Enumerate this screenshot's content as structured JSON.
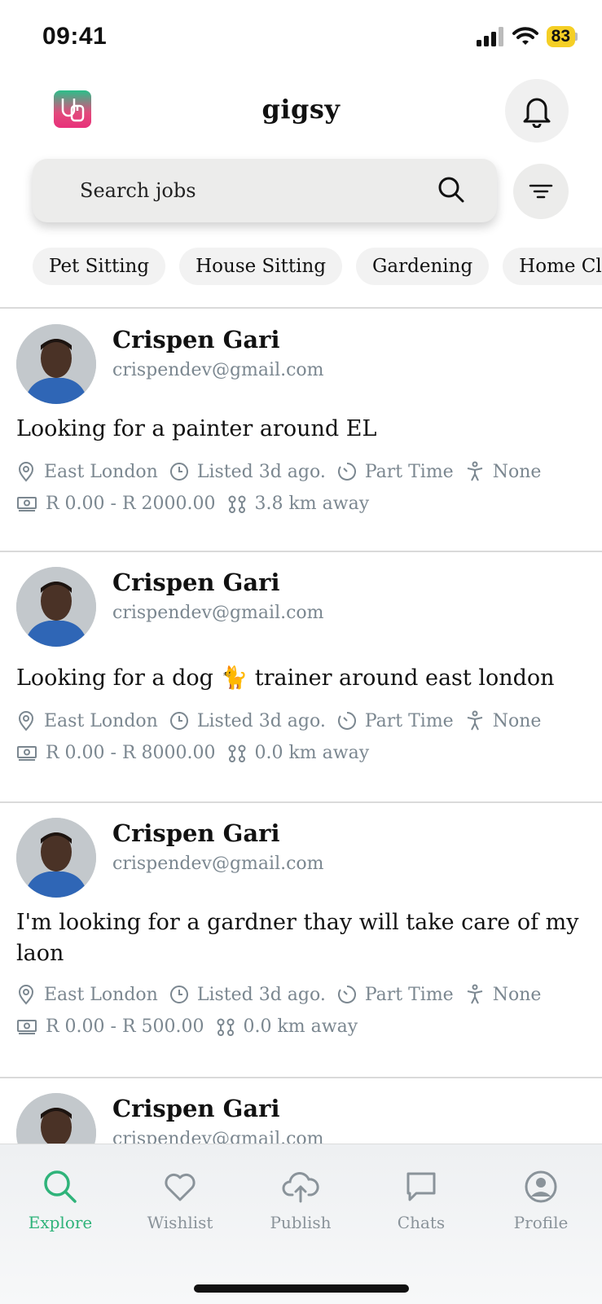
{
  "status_bar": {
    "time": "09:41",
    "battery": "83"
  },
  "header": {
    "title": "gigsy",
    "logo_icon": "gigsy-logo",
    "bell_icon": "bell-icon"
  },
  "search": {
    "placeholder": "Search jobs"
  },
  "categories": [
    "Pet Sitting",
    "House Sitting",
    "Gardening",
    "Home Cleani"
  ],
  "posts": [
    {
      "name": "Crispen Gari",
      "email": "crispendev@gmail.com",
      "title": "Looking for a painter around EL",
      "location": "East London",
      "listed": "Listed 3d ago.",
      "job_type": "Part Time",
      "accessibility": "None",
      "price": "R 0.00 - R 2000.00",
      "distance": "3.8 km away"
    },
    {
      "name": "Crispen Gari",
      "email": "crispendev@gmail.com",
      "title": "Looking  for a dog 🐈 trainer around east london",
      "location": "East London",
      "listed": "Listed 3d ago.",
      "job_type": "Part Time",
      "accessibility": "None",
      "price": "R 0.00 - R 8000.00",
      "distance": "0.0 km away"
    },
    {
      "name": "Crispen Gari",
      "email": "crispendev@gmail.com",
      "title": "I'm  looking  for a gardner thay will take care of my laon",
      "location": "East London",
      "listed": "Listed 3d ago.",
      "job_type": "Part Time",
      "accessibility": "None",
      "price": "R 0.00 - R 500.00",
      "distance": "0.0 km away"
    },
    {
      "name": "Crispen Gari",
      "email": "crispendev@gmail.com"
    }
  ],
  "tabs": [
    {
      "label": "Explore",
      "icon": "search-icon",
      "active": true
    },
    {
      "label": "Wishlist",
      "icon": "heart-icon",
      "active": false
    },
    {
      "label": "Publish",
      "icon": "cloud-upload-icon",
      "active": false
    },
    {
      "label": "Chats",
      "icon": "chat-bubble-icon",
      "active": false
    },
    {
      "label": "Profile",
      "icon": "user-circle-icon",
      "active": false
    }
  ],
  "colors": {
    "accent": "#2fb37a",
    "muted": "#7b8790",
    "battery": "#f5cf25"
  }
}
